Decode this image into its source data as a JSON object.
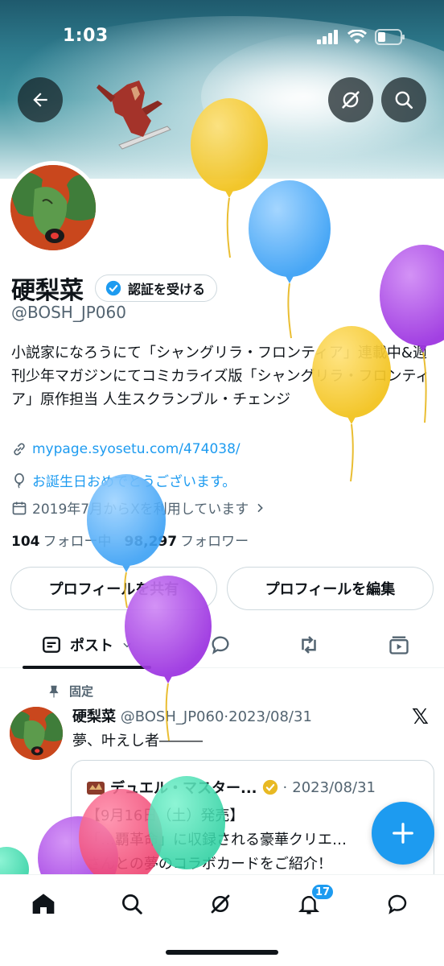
{
  "status_bar": {
    "time": "1:03"
  },
  "profile": {
    "display_name": "硬梨菜",
    "verify_button": "認証を受ける",
    "handle": "@BOSH_JP060",
    "bio": "小説家になろうにて「シャングリラ・フロンティア」連載中&週刊少年マガジンにてコミカライズ版「シャングリラ・フロンティア」原作担当 人生スクランブル・チェンジ",
    "link": "mypage.syosetu.com/474038/",
    "birthday": "お誕生日おめでとうございます。",
    "joined": "2019年7月からXを利用しています",
    "following_count": "104",
    "following_label": "フォロー中",
    "followers_count": "98,297",
    "followers_label": "フォロワー"
  },
  "buttons": {
    "share": "プロフィールを共有",
    "edit": "プロフィールを編集"
  },
  "tabs": {
    "posts": "ポスト"
  },
  "pinned_post": {
    "pinned_label": "固定",
    "author": "硬梨菜",
    "handle": "@BOSH_JP060",
    "date": "2023/08/31",
    "text": "夢、叶えし者―――",
    "quote": {
      "author": "デュエル・マスター...",
      "date": "2023/08/31",
      "line1": "【9月16日（土）発売】",
      "line2": "「…覇革命」に収録される豪華クリエ…",
      "line3": "さんとの夢のコラボカードをご紹介！"
    }
  },
  "bottom_nav": {
    "notifications_badge": "17"
  },
  "colors": {
    "accent": "#1d9bf0",
    "text": "#0f1419",
    "muted": "#536471"
  },
  "icons": [
    "back-arrow-icon",
    "grok-icon",
    "search-icon",
    "verified-icon",
    "link-icon",
    "balloon-icon",
    "calendar-icon",
    "chevron-right-icon",
    "pin-icon",
    "x-logo-icon",
    "compose-plus-icon",
    "home-icon",
    "bell-icon",
    "mail-icon"
  ]
}
